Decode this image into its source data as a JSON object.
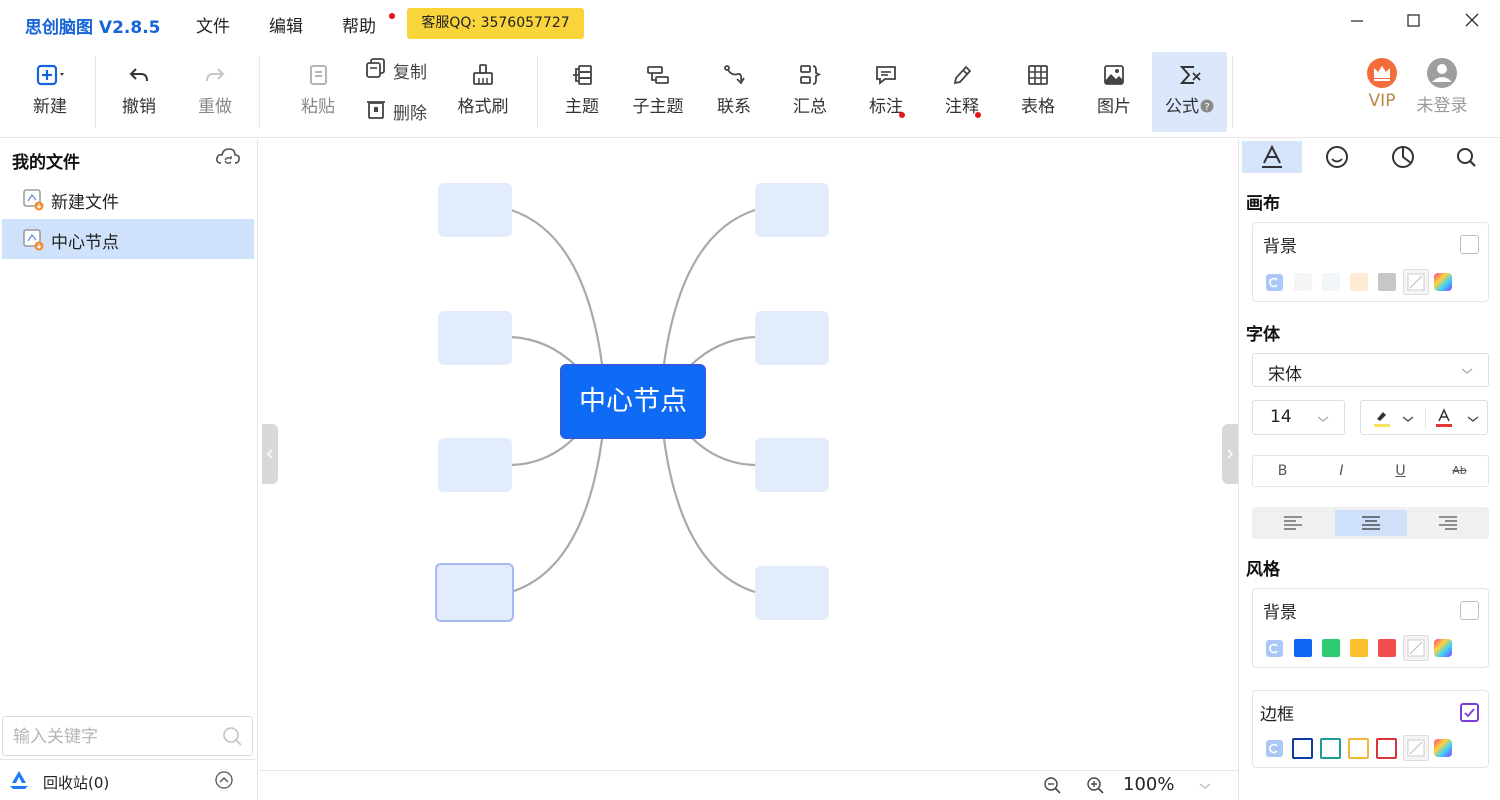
{
  "app": {
    "title": "思创脑图 V2.8.5",
    "menu": [
      "文件",
      "编辑",
      "帮助"
    ],
    "support": "客服QQ: 3576057727"
  },
  "toolbar": {
    "new": "新建",
    "undo": "撤销",
    "redo": "重做",
    "paste": "粘贴",
    "copy": "复制",
    "delete": "删除",
    "format_brush": "格式刷",
    "topic": "主题",
    "subtopic": "子主题",
    "relation": "联系",
    "summary": "汇总",
    "mark": "标注",
    "note": "注释",
    "table": "表格",
    "image": "图片",
    "formula": "公式",
    "vip": "VIP",
    "login": "未登录"
  },
  "left": {
    "title": "我的文件",
    "files": [
      "新建文件",
      "中心节点"
    ],
    "search_placeholder": "输入关键字",
    "recycle": "回收站(0)"
  },
  "canvas": {
    "center_label": "中心节点",
    "zoom": "100%"
  },
  "right": {
    "canvas_section": "画布",
    "background": "背景",
    "font_section": "字体",
    "font_family": "宋体",
    "font_size": "14",
    "bold": "B",
    "italic": "I",
    "underline": "U",
    "strike": "Ab",
    "style_section": "风格",
    "style_background": "背景",
    "border": "边框",
    "colors": {
      "canvas_swatches": [
        "#f4f5f7",
        "#f1f7f8",
        "#fdebd4",
        "#c7c7c7"
      ],
      "style_swatches": [
        "#1064f4",
        "#2ecc71",
        "#fbc02d",
        "#f04d4d"
      ],
      "border_swatches": [
        "#0c3d9c",
        "#1e9c96",
        "#f1b73c",
        "#d9343a"
      ],
      "accent": "#0d6bf5"
    }
  }
}
